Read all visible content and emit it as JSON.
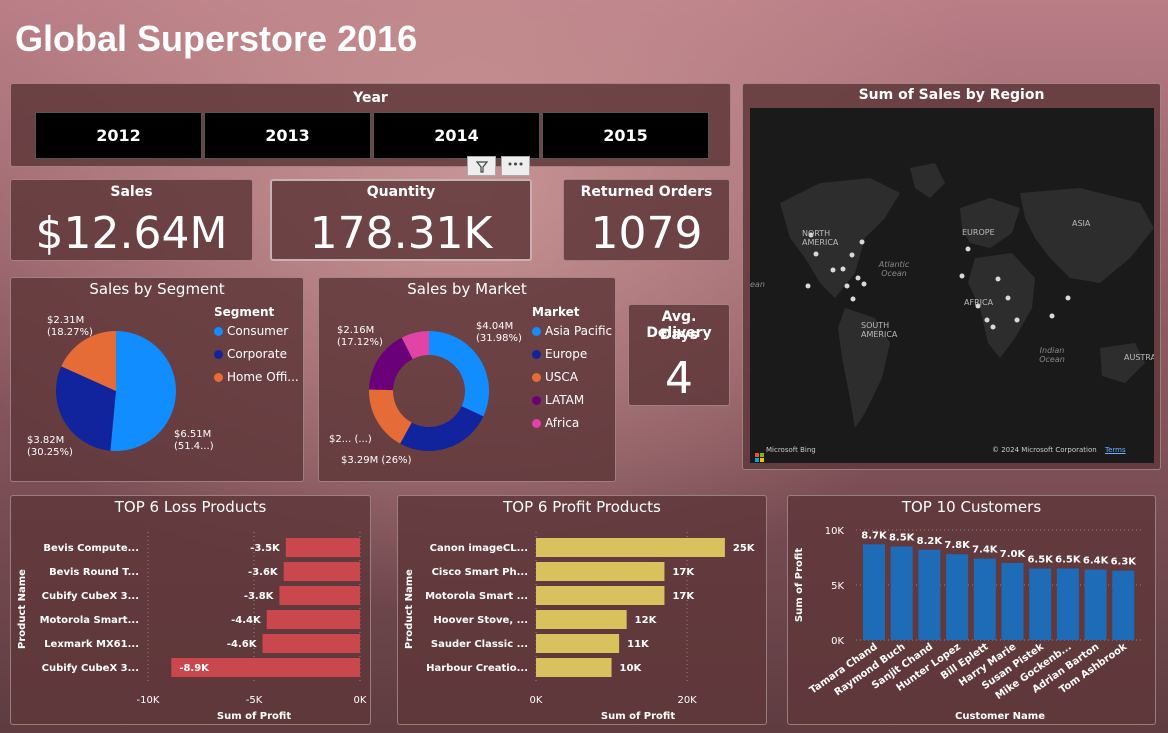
{
  "page": {
    "title": "Global Superstore 2016"
  },
  "year_slicer": {
    "title": "Year",
    "options": [
      "2012",
      "2013",
      "2014",
      "2015"
    ]
  },
  "kpis": {
    "sales": {
      "label": "Sales",
      "value": "$12.64M"
    },
    "quantity": {
      "label": "Quantity",
      "value": "178.31K"
    },
    "returned": {
      "label": "Returned Orders",
      "value": "1079"
    },
    "delivery": {
      "label_line1": "Avg. Delivery",
      "label_line2": "Days",
      "value": "4"
    }
  },
  "map": {
    "title": "Sum of Sales by Region",
    "labels": {
      "na": "NORTH AMERICA",
      "sa": "SOUTH AMERICA",
      "europe": "EUROPE",
      "asia": "ASIA",
      "africa": "AFRICA",
      "austral": "AUSTRAL",
      "atlantic": "Atlantic Ocean",
      "indian": "Indian Ocean",
      "ean": "ean"
    },
    "attribution_bing": "Microsoft Bing",
    "attribution_copy": "© 2024 Microsoft Corporation",
    "attribution_terms": "Terms"
  },
  "colors": {
    "consumer": "#118dff",
    "corporate": "#12239e",
    "home_office": "#e66c37",
    "asia_pacific": "#118dff",
    "europe": "#12239e",
    "usca": "#e66c37",
    "latam": "#6b007b",
    "africa": "#e044a7",
    "loss_bar": "#c9474d",
    "profit_bar": "#d9c15e",
    "customer_bar": "#1e6bb8"
  },
  "chart_data": [
    {
      "type": "pie",
      "title": "Sales by Segment",
      "legend_title": "Segment",
      "categories": [
        "Consumer",
        "Corporate",
        "Home Offi..."
      ],
      "values": [
        6.51,
        3.82,
        2.31
      ],
      "labels": [
        "$6.51M\n(51.4...)",
        "$3.82M\n(30.25%)",
        "$2.31M\n(18.27%)"
      ]
    },
    {
      "type": "pie",
      "subtype": "donut",
      "title": "Sales by Market",
      "legend_title": "Market",
      "categories": [
        "Asia Pacific",
        "Europe",
        "USCA",
        "LATAM",
        "Africa"
      ],
      "values": [
        4.04,
        3.29,
        2.2,
        2.16,
        0.95
      ],
      "labels": [
        "$4.04M\n(31.98%)",
        "$3.29M (26%)",
        "$2... (...)",
        "$2.16M\n(17.12%)",
        ""
      ]
    },
    {
      "type": "bar",
      "orientation": "horizontal",
      "title": "TOP 6 Loss Products",
      "categories": [
        "Bevis Compute...",
        "Bevis Round T...",
        "Cubify CubeX 3...",
        "Motorola Smart...",
        "Lexmark MX61...",
        "Cubify CubeX 3..."
      ],
      "values": [
        -3.5,
        -3.6,
        -3.8,
        -4.4,
        -4.6,
        -8.9
      ],
      "data_labels": [
        "-3.5K",
        "-3.6K",
        "-3.8K",
        "-4.4K",
        "-4.6K",
        "-8.9K"
      ],
      "xlabel": "Sum of Profit",
      "ylabel": "Product Name",
      "xlim": [
        -10,
        0
      ],
      "xticks": [
        "-10K",
        "-5K",
        "0K"
      ]
    },
    {
      "type": "bar",
      "orientation": "horizontal",
      "title": "TOP 6 Profit Products",
      "categories": [
        "Canon imageCL...",
        "Cisco Smart Ph...",
        "Motorola Smart ...",
        "Hoover Stove, ...",
        "Sauder Classic ...",
        "Harbour Creatio..."
      ],
      "values": [
        25,
        17,
        17,
        12,
        11,
        10
      ],
      "data_labels": [
        "25K",
        "17K",
        "17K",
        "12K",
        "11K",
        "10K"
      ],
      "xlabel": "Sum of Profit",
      "ylabel": "Product Name",
      "xlim": [
        0,
        27
      ],
      "xticks": [
        "0K",
        "20K"
      ]
    },
    {
      "type": "bar",
      "orientation": "vertical",
      "title": "TOP 10 Customers",
      "categories": [
        "Tamara Chand",
        "Raymond Buch",
        "Sanjit Chand",
        "Hunter Lopez",
        "Bill Eplett",
        "Harry Marie",
        "Susan Pistek",
        "Mike Gockenb...",
        "Adrian Barton",
        "Tom Ashbrook"
      ],
      "values": [
        8.7,
        8.5,
        8.2,
        7.8,
        7.4,
        7.0,
        6.5,
        6.5,
        6.4,
        6.3
      ],
      "data_labels": [
        "8.7K",
        "8.5K",
        "8.2K",
        "7.8K",
        "7.4K",
        "7.0K",
        "6.5K",
        "6.5K",
        "6.4K",
        "6.3K"
      ],
      "xlabel": "Customer Name",
      "ylabel": "Sum of Profit",
      "ylim": [
        0,
        10
      ],
      "yticks": [
        "0K",
        "5K",
        "10K"
      ]
    }
  ]
}
